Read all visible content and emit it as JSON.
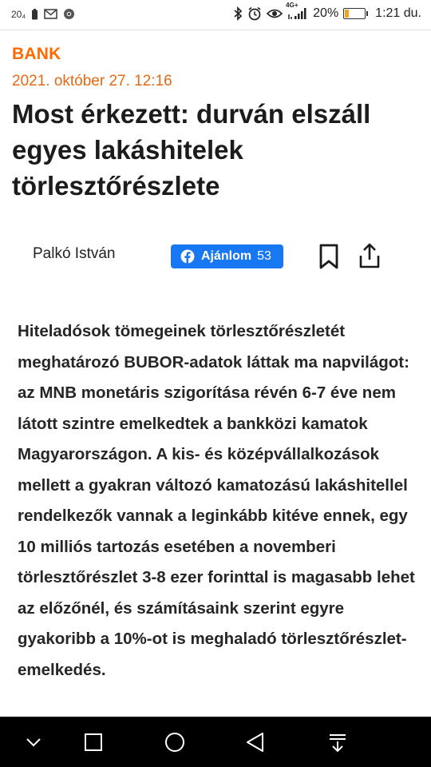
{
  "status_bar": {
    "left_text": "20₄",
    "battery_percent": "20%",
    "battery_level": 0.2,
    "time": "1:21 du.",
    "network": "4G+",
    "icons": [
      "battery-small-icon",
      "gmail-icon",
      "chrome-icon",
      "bluetooth-icon",
      "alarm-icon",
      "eye-icon",
      "signal-icon",
      "battery-icon"
    ]
  },
  "article": {
    "category": "BANK",
    "date": "2021. október 27. 12:16",
    "title": "Most érkezett: durván elszáll egyes lakáshitelek törlesztőrészlete",
    "author": "Palkó István",
    "fb_button": {
      "label": "Ajánlom",
      "count": "53"
    },
    "body": "Hiteladósok tömegeinek törlesztőrészletét meghatározó BUBOR-adatok láttak ma napvilágot: az MNB monetáris szigorítása révén 6-7 éve nem látott szintre emelkedtek a bankközi kamatok Magyarországon. A kis- és középvállalkozások mellett a gyakran változó kamatozású lakáshitellel rendelkezők vannak a leginkább kitéve ennek, egy 10 milliós tartozás esetében a novemberi törlesztőrészlet 3-8 ezer forinttal is magasabb lehet az előzőnél, és számításaink szerint egyre gyakoribb a 10%-ot is meghaladó törlesztőrészlet-emelkedés."
  },
  "colors": {
    "accent": "#ff6a00",
    "date": "#e46a13",
    "facebook": "#1877f2",
    "nav_bg": "#000000"
  },
  "nav_bar": {
    "icons": [
      "chevron-down-icon",
      "recents-icon",
      "home-icon",
      "back-icon",
      "download-icon"
    ]
  }
}
